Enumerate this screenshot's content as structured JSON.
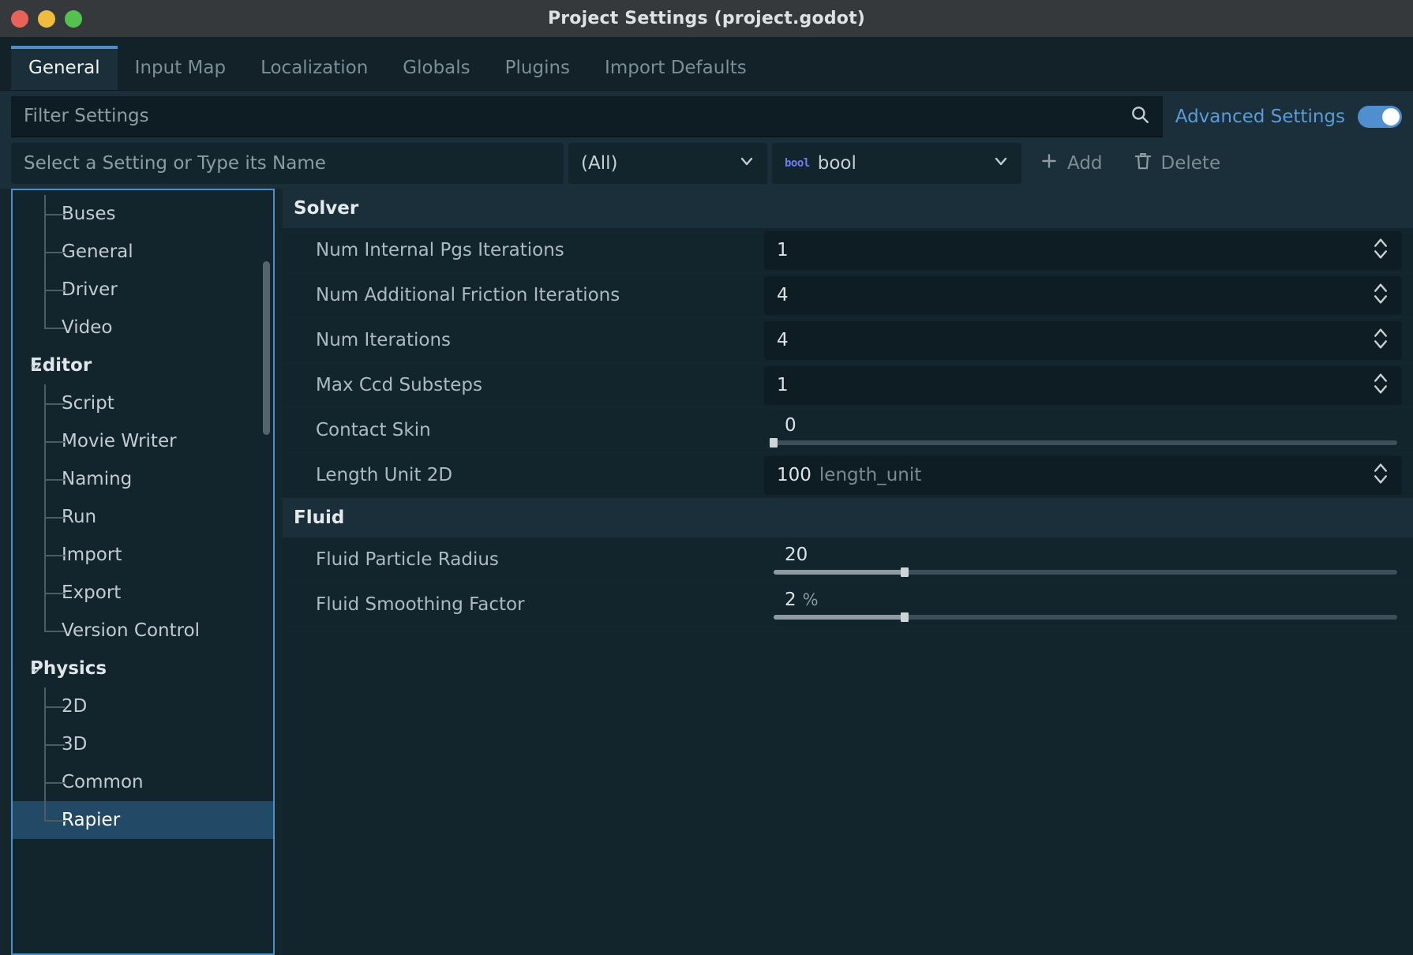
{
  "window": {
    "title": "Project Settings (project.godot)",
    "traffic_lights": [
      "close",
      "minimize",
      "maximize"
    ],
    "colors": {
      "close": "#e8625a",
      "minimize": "#f0bc40",
      "maximize": "#55c14e",
      "accent": "#4b8ecb",
      "link": "#5b9bd8",
      "selection": "#27526e"
    }
  },
  "tabs": [
    {
      "label": "General",
      "active": true
    },
    {
      "label": "Input Map",
      "active": false
    },
    {
      "label": "Localization",
      "active": false
    },
    {
      "label": "Globals",
      "active": false
    },
    {
      "label": "Plugins",
      "active": false
    },
    {
      "label": "Import Defaults",
      "active": false
    }
  ],
  "filter": {
    "placeholder": "Filter Settings",
    "value": "",
    "search_icon": "search-icon",
    "advanced_label": "Advanced Settings",
    "advanced_enabled": true
  },
  "add_setting": {
    "name_placeholder": "Select a Setting or Type its Name",
    "name_value": "",
    "type_filter": "(All)",
    "type_selected": "bool",
    "type_glyph": "bool",
    "add_label": "Add",
    "delete_label": "Delete"
  },
  "tree": {
    "items": [
      {
        "label": "Buses",
        "level": "child",
        "selected": false
      },
      {
        "label": "General",
        "level": "child",
        "selected": false
      },
      {
        "label": "Driver",
        "level": "child",
        "selected": false
      },
      {
        "label": "Video",
        "level": "child",
        "selected": false
      },
      {
        "label": "Editor",
        "level": "group",
        "selected": false,
        "expanded": true
      },
      {
        "label": "Script",
        "level": "child",
        "selected": false
      },
      {
        "label": "Movie Writer",
        "level": "child",
        "selected": false
      },
      {
        "label": "Naming",
        "level": "child",
        "selected": false
      },
      {
        "label": "Run",
        "level": "child",
        "selected": false
      },
      {
        "label": "Import",
        "level": "child",
        "selected": false
      },
      {
        "label": "Export",
        "level": "child",
        "selected": false
      },
      {
        "label": "Version Control",
        "level": "child",
        "selected": false
      },
      {
        "label": "Physics",
        "level": "group",
        "selected": false,
        "expanded": true
      },
      {
        "label": "2D",
        "level": "child",
        "selected": false
      },
      {
        "label": "3D",
        "level": "child",
        "selected": false
      },
      {
        "label": "Common",
        "level": "child",
        "selected": false
      },
      {
        "label": "Rapier",
        "level": "child",
        "selected": true
      }
    ]
  },
  "sections": [
    {
      "title": "Solver",
      "rows": [
        {
          "label": "Num Internal Pgs Iterations",
          "value": "1",
          "suffix": "",
          "kind": "spinbox"
        },
        {
          "label": "Num Additional Friction Iterations",
          "value": "4",
          "suffix": "",
          "kind": "spinbox"
        },
        {
          "label": "Num Iterations",
          "value": "4",
          "suffix": "",
          "kind": "spinbox"
        },
        {
          "label": "Max Ccd Substeps",
          "value": "1",
          "suffix": "",
          "kind": "spinbox"
        },
        {
          "label": "Contact Skin",
          "value": "0",
          "suffix": "",
          "kind": "slider",
          "fill_percent": 0
        },
        {
          "label": "Length Unit 2D",
          "value": "100",
          "suffix": "length_unit",
          "kind": "spinbox"
        }
      ]
    },
    {
      "title": "Fluid",
      "rows": [
        {
          "label": "Fluid Particle Radius",
          "value": "20",
          "suffix": "",
          "kind": "slider",
          "fill_percent": 21
        },
        {
          "label": "Fluid Smoothing Factor",
          "value": "2",
          "suffix": "%",
          "kind": "slider",
          "fill_percent": 21
        }
      ]
    }
  ]
}
